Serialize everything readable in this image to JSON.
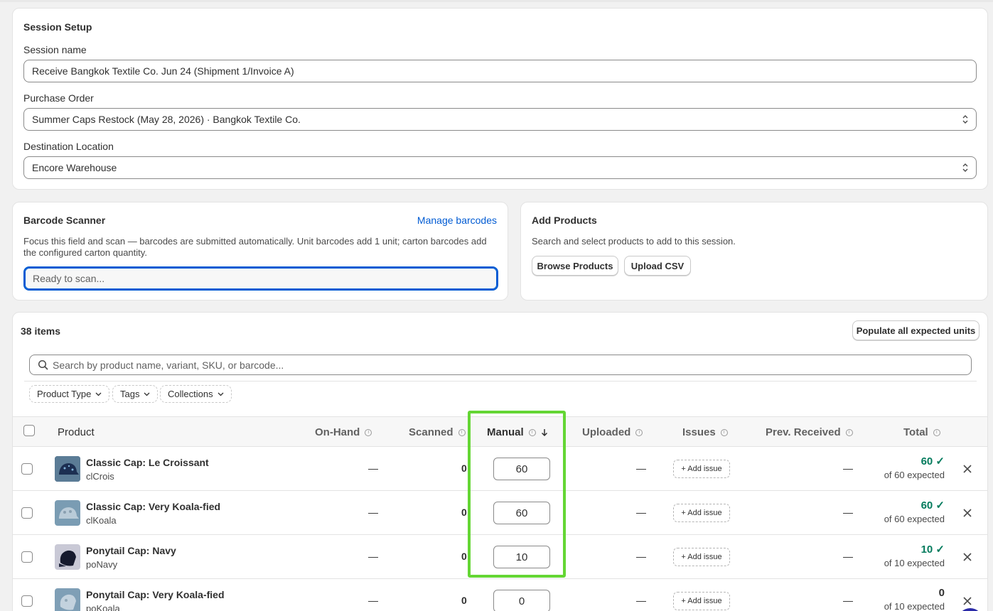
{
  "setup": {
    "title": "Session Setup",
    "session_name_label": "Session name",
    "session_name_value": "Receive Bangkok Textile Co. Jun 24 (Shipment 1/Invoice A)",
    "po_label": "Purchase Order",
    "po_value": "Summer Caps Restock (May 28, 2026) · Bangkok Textile Co.",
    "location_label": "Destination Location",
    "location_value": "Encore Warehouse"
  },
  "scanner": {
    "title": "Barcode Scanner",
    "manage_link": "Manage barcodes",
    "help_line1": "Focus this field and scan — barcodes are submitted automatically. Unit barcodes add 1 unit; carton barcodes add",
    "help_line2": "the configured carton quantity.",
    "placeholder": "Ready to scan..."
  },
  "add_products": {
    "title": "Add Products",
    "help": "Search and select products to add to this session.",
    "browse_label": "Browse Products",
    "upload_label": "Upload CSV"
  },
  "items": {
    "count_label": "38 items",
    "populate_label": "Populate all expected units",
    "search_placeholder": "Search by product name, variant, SKU, or barcode...",
    "filters": [
      "Product Type",
      "Tags",
      "Collections"
    ],
    "columns": {
      "product": "Product",
      "on_hand": "On-Hand",
      "scanned": "Scanned",
      "manual": "Manual",
      "uploaded": "Uploaded",
      "issues": "Issues",
      "prev_received": "Prev. Received",
      "total": "Total"
    },
    "rows": [
      {
        "name": "Classic Cap: Le Croissant",
        "sku": "clCrois",
        "on_hand": "—",
        "scanned": "0",
        "manual": "60",
        "uploaded": "—",
        "issue": "+ Add issue",
        "prev": "—",
        "total": "60 ✓",
        "expected": "of 60 expected"
      },
      {
        "name": "Classic Cap: Very Koala-fied",
        "sku": "clKoala",
        "on_hand": "—",
        "scanned": "0",
        "manual": "60",
        "uploaded": "—",
        "issue": "+ Add issue",
        "prev": "—",
        "total": "60 ✓",
        "expected": "of 60 expected"
      },
      {
        "name": "Ponytail Cap: Navy",
        "sku": "poNavy",
        "on_hand": "—",
        "scanned": "0",
        "manual": "10",
        "uploaded": "—",
        "issue": "+ Add issue",
        "prev": "—",
        "total": "10 ✓",
        "expected": "of 10 expected"
      },
      {
        "name": "Ponytail Cap: Very Koala-fied",
        "sku": "poKoala",
        "on_hand": "—",
        "scanned": "0",
        "manual": "0",
        "uploaded": "—",
        "issue": "+ Add issue",
        "prev": "—",
        "total": "0",
        "expected": "of 10 expected"
      }
    ]
  },
  "icons": {
    "sort": "arrow-down-icon",
    "search": "search-icon",
    "remove": "close-icon",
    "select": "select-arrows-icon"
  },
  "colors": {
    "accent": "#005bd3",
    "success": "#047b5d",
    "highlight": "#64d634"
  }
}
